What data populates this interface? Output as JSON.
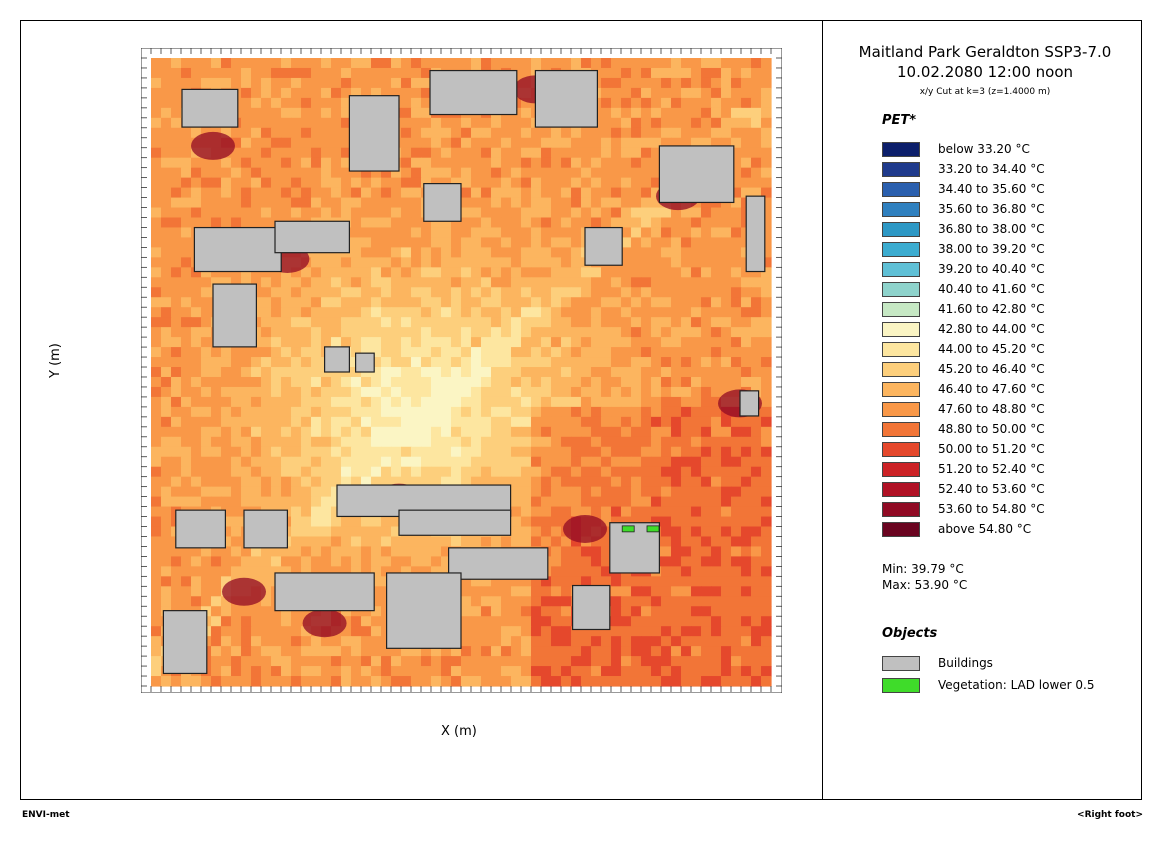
{
  "chart_data": {
    "type": "heatmap",
    "title": "Maitland Park Geraldton SSP3-7.0 10.02.2080 12:00 noon",
    "subtitle": "x/y Cut at k=3 (z=1.4000 m)",
    "xlabel": "X (m)",
    "ylabel": "Y (m)",
    "variable": "PET*",
    "legend": [
      {
        "label": "below 33.20 °C",
        "color": "#0c1f6b"
      },
      {
        "label": "33.20 to 34.40 °C",
        "color": "#1f3a8c"
      },
      {
        "label": "34.40 to 35.60 °C",
        "color": "#2a5fae"
      },
      {
        "label": "35.60 to 36.80 °C",
        "color": "#2f80bf"
      },
      {
        "label": "36.80 to 38.00 °C",
        "color": "#2d98c5"
      },
      {
        "label": "38.00 to 39.20 °C",
        "color": "#3cacd0"
      },
      {
        "label": "39.20 to 40.40 °C",
        "color": "#5fc0d6"
      },
      {
        "label": "40.40 to 41.60 °C",
        "color": "#8ed3cc"
      },
      {
        "label": "41.60 to 42.80 °C",
        "color": "#c6e8c4"
      },
      {
        "label": "42.80 to 44.00 °C",
        "color": "#fbf5c4"
      },
      {
        "label": "44.00 to 45.20 °C",
        "color": "#fde6a0"
      },
      {
        "label": "45.20 to 46.40 °C",
        "color": "#fdcf7c"
      },
      {
        "label": "46.40 to 47.60 °C",
        "color": "#fcb55f"
      },
      {
        "label": "47.60 to 48.80 °C",
        "color": "#f99848"
      },
      {
        "label": "48.80 to 50.00 °C",
        "color": "#f27537"
      },
      {
        "label": "50.00 to 51.20 °C",
        "color": "#e5482c"
      },
      {
        "label": "51.20 to 52.40 °C",
        "color": "#cc2226"
      },
      {
        "label": "52.40 to 53.60 °C",
        "color": "#b01125"
      },
      {
        "label": "53.60 to 54.80 °C",
        "color": "#900a24"
      },
      {
        "label": "above 54.80 °C",
        "color": "#6a0420"
      }
    ],
    "min_label": "Min: 39.79 °C",
    "max_label": "Max: 53.90 °C",
    "grid": false
  },
  "objects": {
    "heading": "Objects",
    "items": [
      {
        "label": "Buildings",
        "color": "#c0c0c0"
      },
      {
        "label": "Vegetation: LAD lower 0.5",
        "color": "#3fdc2a"
      }
    ]
  },
  "footer": {
    "left": "ENVI-met",
    "right": "<Right foot>"
  }
}
